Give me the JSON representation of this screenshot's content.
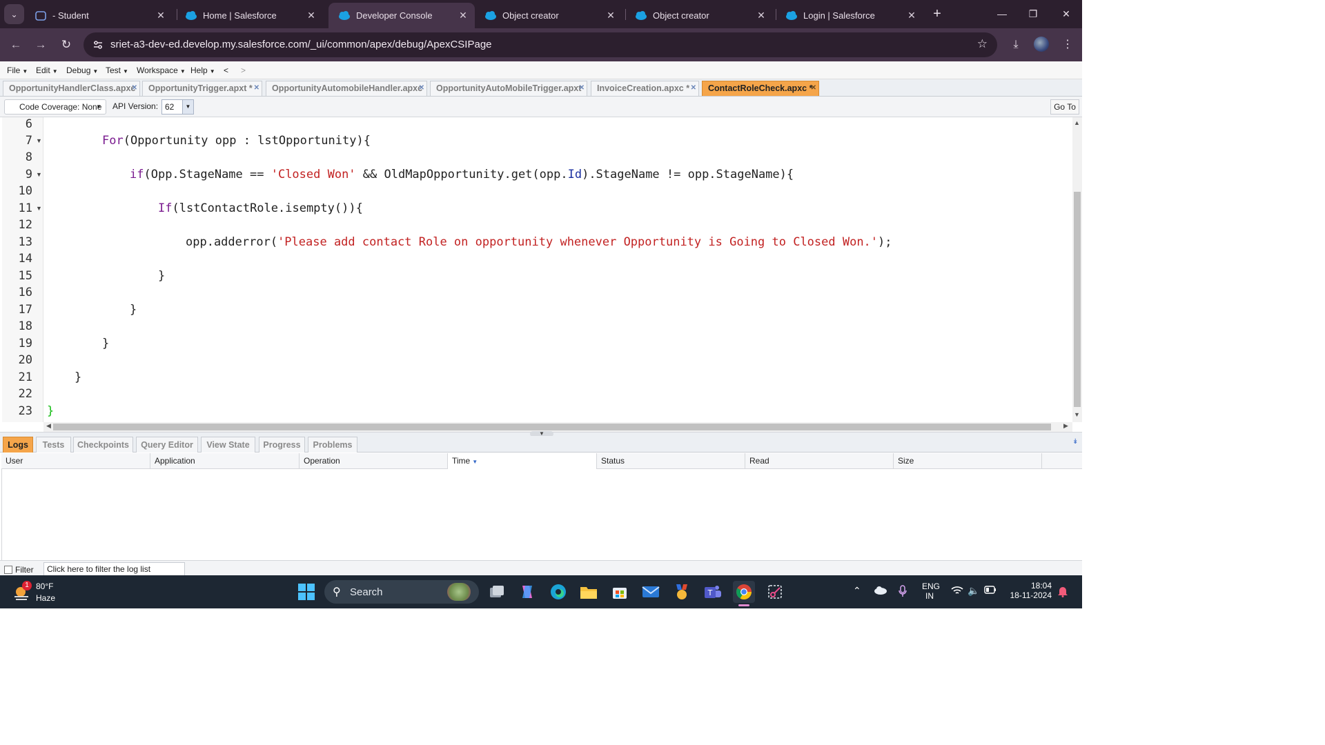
{
  "browser": {
    "tabs": [
      {
        "title": " - Student",
        "icon": "student-icon"
      },
      {
        "title": "Home | Salesforce",
        "icon": "salesforce-cloud-icon"
      },
      {
        "title": "Developer Console",
        "icon": "salesforce-cloud-icon"
      },
      {
        "title": "Object creator",
        "icon": "salesforce-cloud-icon"
      },
      {
        "title": "Object creator",
        "icon": "salesforce-cloud-icon"
      },
      {
        "title": "Login | Salesforce",
        "icon": "salesforce-cloud-icon"
      }
    ],
    "url": "sriet-a3-dev-ed.develop.my.salesforce.com/_ui/common/apex/debug/ApexCSIPage"
  },
  "console": {
    "menu": [
      "File",
      "Edit",
      "Debug",
      "Test",
      "Workspace",
      "Help",
      "<",
      ">"
    ],
    "file_tabs": [
      "OpportunityHandlerClass.apxc",
      "OpportunityTrigger.apxt *",
      "OpportunityAutomobileHandler.apxc",
      "OpportunityAutoMobileTrigger.apxt",
      "InvoiceCreation.apxc *",
      "ContactRoleCheck.apxc *"
    ],
    "toolbar": {
      "coverage": "Code Coverage: None",
      "api_label": "API Version:",
      "api_value": "62",
      "goto": "Go To"
    },
    "line_numbers": [
      "6",
      "7",
      "8",
      "9",
      "10",
      "11",
      "12",
      "13",
      "14",
      "15",
      "16",
      "17",
      "18",
      "19",
      "20",
      "21",
      "22",
      "23"
    ],
    "code": {
      "l7_kw": "For",
      "l7_rest": "(Opportunity opp : lstOpportunity){",
      "l9_kw": "if",
      "l9_a": "(Opp.StageName == ",
      "l9_str": "'Closed Won'",
      "l9_b": " && OldMapOpportunity.get(opp.",
      "l9_id": "Id",
      "l9_c": ").StageName != opp.StageName){",
      "l11_kw": "If",
      "l11_rest": "(lstContactRole.isempty()){",
      "l13_a": "opp.adderror(",
      "l13_str": "'Please add contact Role on opportunity whenever Opportunity is Going to Closed Won.'",
      "l13_b": ");",
      "l15": "}",
      "l17": "}",
      "l19": "}",
      "l21": "}",
      "l23": "}"
    },
    "bottom_tabs": [
      "Logs",
      "Tests",
      "Checkpoints",
      "Query Editor",
      "View State",
      "Progress",
      "Problems"
    ],
    "log_columns": [
      "User",
      "Application",
      "Operation",
      "Time",
      "Status",
      "Read",
      "Size"
    ],
    "filter": {
      "label": "Filter",
      "placeholder": "Click here to filter the log list"
    }
  },
  "taskbar": {
    "weather": {
      "temp": "80°F",
      "condition": "Haze",
      "badge": "1"
    },
    "search": "Search",
    "lang": "ENG",
    "region": "IN",
    "time": "18:04",
    "date": "18-11-2024"
  }
}
